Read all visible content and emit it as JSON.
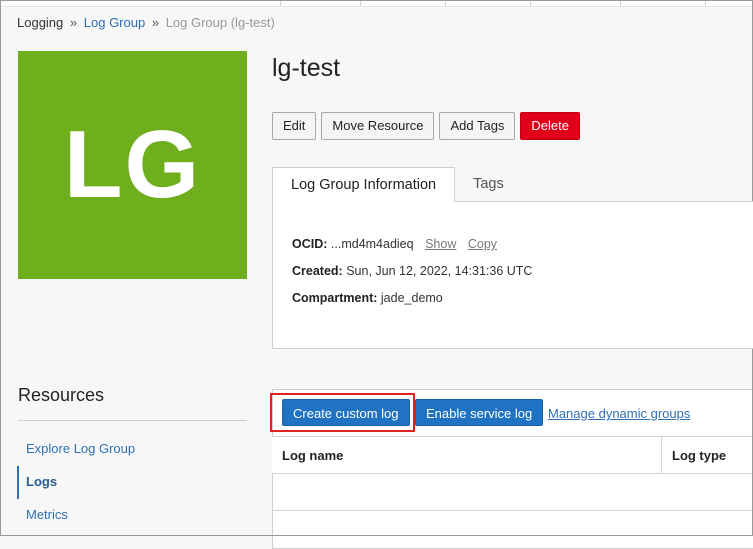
{
  "breadcrumb": {
    "logging": "Logging",
    "separator": "»",
    "log_group": "Log Group",
    "current": "Log Group (lg-test)"
  },
  "logo": {
    "text": "LG",
    "color": "#6fae1d"
  },
  "title": "lg-test",
  "actions": {
    "edit": "Edit",
    "move": "Move Resource",
    "add_tags": "Add Tags",
    "delete": "Delete"
  },
  "tabs": {
    "info": "Log Group Information",
    "tags": "Tags"
  },
  "info": {
    "ocid_label": "OCID:",
    "ocid_value": "...md4m4adieq",
    "show": "Show",
    "copy": "Copy",
    "created_label": "Created:",
    "created_value": "Sun, Jun 12, 2022, 14:31:36 UTC",
    "compartment_label": "Compartment:",
    "compartment_value": "jade_demo"
  },
  "resources": {
    "title": "Resources",
    "items": [
      {
        "label": "Explore Log Group"
      },
      {
        "label": "Logs"
      },
      {
        "label": "Metrics"
      }
    ]
  },
  "logs": {
    "create_custom": "Create custom log",
    "enable_service": "Enable service log",
    "manage_dynamic": "Manage dynamic groups",
    "columns": [
      "Log name",
      "Log type"
    ]
  },
  "colors": {
    "link": "#2f6fb3",
    "primary": "#1f73c2",
    "danger": "#e0001a",
    "highlight": "#d22"
  }
}
